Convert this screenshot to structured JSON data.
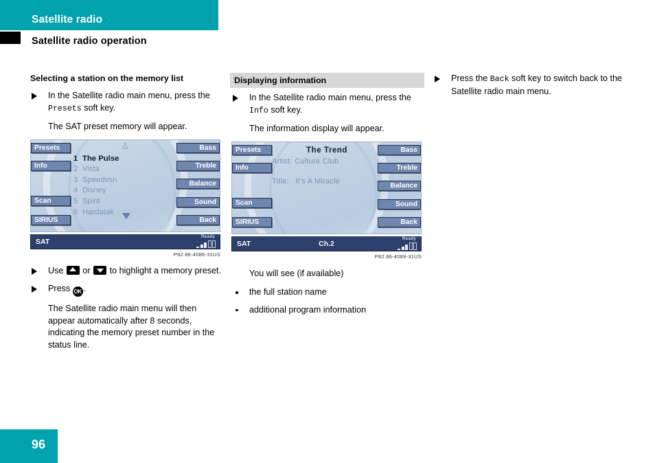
{
  "header": {
    "title": "Satellite radio",
    "section": "Satellite radio operation"
  },
  "footer": {
    "page_number": "96"
  },
  "colors": {
    "brand_teal": "#00a3ad",
    "softkey_blue": "#6f86ae",
    "statusbar_blue": "#2d3f6b",
    "display_bg": "#c3d3e4",
    "band_gray": "#d7d7d7"
  },
  "column1": {
    "heading": "Selecting a station on the memory list",
    "step1_a": "In the Satellite radio main menu, press",
    "step1_b": "the ",
    "step1_key": "Presets",
    "step1_c": " soft key.",
    "result1": "The SAT preset memory will appear.",
    "step2_a": "Use ",
    "step2_b": " or ",
    "step2_c": " to highlight a memory preset.",
    "step3_a": "Press ",
    "step3_ok": "OK",
    "step3_b": ".",
    "result2": "The Satellite radio main menu will then appear automatically after 8 seconds, indicating the memory preset number in the status line.",
    "figure": {
      "caption": "P82.86-4086-31US",
      "softkeys_left": [
        "Presets",
        "Info",
        "Scan",
        "SIRIUS"
      ],
      "softkeys_right": [
        "Bass",
        "Treble",
        "Balance",
        "Sound",
        "Back"
      ],
      "scroll_up_icon": "triangle-up-outline",
      "scroll_down_icon": "triangle-down-filled",
      "presets": [
        {
          "num": "1",
          "name": "The Pulse",
          "active": true
        },
        {
          "num": "2",
          "name": "Vista",
          "active": false
        },
        {
          "num": "3",
          "name": "Speedvsn",
          "active": false
        },
        {
          "num": "4",
          "name": "Disney",
          "active": false
        },
        {
          "num": "5",
          "name": "Spirit",
          "active": false
        },
        {
          "num": "6",
          "name": "Hardatak",
          "active": false
        }
      ],
      "status": {
        "source": "SAT",
        "channel": "",
        "ready": "Ready"
      }
    }
  },
  "column2": {
    "heading": "Displaying information",
    "step1_a": "In the Satellite radio main menu, press",
    "step1_b": "the ",
    "step1_key": "Info",
    "step1_c": " soft key.",
    "result1": "The information display will appear.",
    "intro": "You will see (if available)",
    "bullets": [
      "the full station name",
      "additional program information"
    ],
    "figure": {
      "caption": "P82.86-4089-31US",
      "softkeys_left": [
        "Presets",
        "Info",
        "Scan",
        "SIRIUS"
      ],
      "softkeys_right": [
        "Bass",
        "Treble",
        "Balance",
        "Sound",
        "Back"
      ],
      "station": "The Trend",
      "artist_label": "Artist:",
      "artist_value": "Culture Club",
      "title_label": "Title:",
      "title_value": "It's A Miracle",
      "status": {
        "source": "SAT",
        "channel": "Ch.2",
        "ready": "Ready"
      }
    }
  },
  "column3": {
    "step1_a": "Press the ",
    "step1_key": "Back",
    "step1_b": " soft key to switch back to the Satellite radio main menu."
  }
}
